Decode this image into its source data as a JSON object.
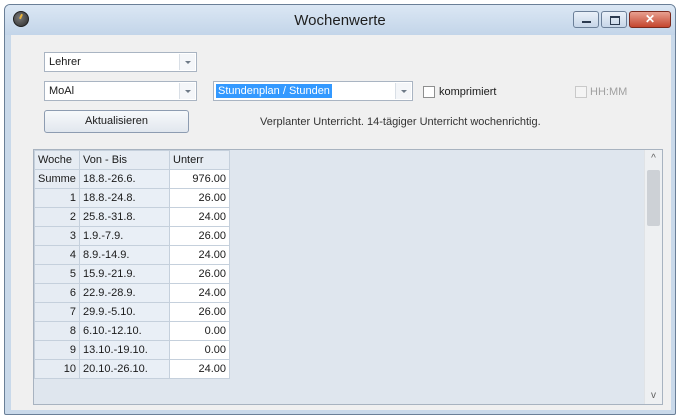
{
  "window": {
    "title": "Wochenwerte",
    "close_glyph": "✕"
  },
  "filters": {
    "type_select": "Lehrer",
    "teacher_select": "MoAl",
    "mode_select": "Stundenplan / Stunden",
    "komprimiert_label": "komprimiert",
    "hhmm_label": "HH:MM"
  },
  "actions": {
    "refresh_label": "Aktualisieren"
  },
  "info_text": "Verplanter Unterricht. 14-tägiger Unterricht wochenrichtig.",
  "table": {
    "headers": [
      "Woche",
      "Von - Bis",
      "Unterr"
    ],
    "sum_row": {
      "woche": "Summe",
      "range": "18.8.-26.6.",
      "value": "976.00"
    },
    "rows": [
      {
        "woche": "1",
        "range": "18.8.-24.8.",
        "value": "26.00"
      },
      {
        "woche": "2",
        "range": "25.8.-31.8.",
        "value": "24.00"
      },
      {
        "woche": "3",
        "range": "1.9.-7.9.",
        "value": "26.00"
      },
      {
        "woche": "4",
        "range": "8.9.-14.9.",
        "value": "24.00"
      },
      {
        "woche": "5",
        "range": "15.9.-21.9.",
        "value": "26.00"
      },
      {
        "woche": "6",
        "range": "22.9.-28.9.",
        "value": "24.00"
      },
      {
        "woche": "7",
        "range": "29.9.-5.10.",
        "value": "26.00"
      },
      {
        "woche": "8",
        "range": "6.10.-12.10.",
        "value": "0.00"
      },
      {
        "woche": "9",
        "range": "13.10.-19.10.",
        "value": "0.00"
      },
      {
        "woche": "10",
        "range": "20.10.-26.10.",
        "value": "24.00"
      }
    ]
  },
  "scrollbar": {
    "up_glyph": "^",
    "down_glyph": "v"
  }
}
